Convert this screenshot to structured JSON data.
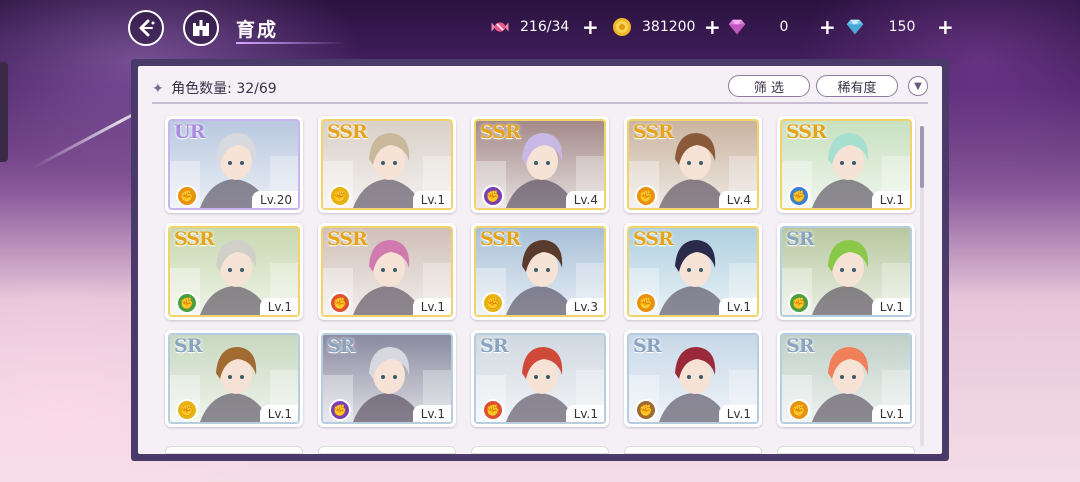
{
  "header": {
    "title": "育成",
    "back_icon": "back-arrow-icon",
    "home_icon": "castle-icon"
  },
  "resources": [
    {
      "name": "candy",
      "icon": "candy-icon",
      "value": "216/34",
      "color": "#e85a8f"
    },
    {
      "name": "gold",
      "icon": "gold-coin-icon",
      "value": "381200",
      "color": "#f2b824"
    },
    {
      "name": "pink-gem",
      "icon": "pink-gem-icon",
      "value": "0",
      "color": "#e07ad8"
    },
    {
      "name": "blue-gem",
      "icon": "blue-gem-icon",
      "value": "150",
      "color": "#6fc7f0"
    }
  ],
  "panel": {
    "count_label": "角色数量:",
    "count_value": "32/69",
    "filter_label": "筛 选",
    "rarity_label": "稀有度"
  },
  "cards": [
    {
      "rarity": "UR",
      "level": "Lv.20",
      "role_color": "#e8920f",
      "hair": "#d9d9e0",
      "bg": "#b9c8e0"
    },
    {
      "rarity": "SSR",
      "level": "Lv.1",
      "role_color": "#e8b20f",
      "hair": "#c9b89a",
      "bg": "#d9d0c8"
    },
    {
      "rarity": "SSR",
      "level": "Lv.4",
      "role_color": "#7a3fb0",
      "hair": "#c8b8e6",
      "bg": "#a48a8a"
    },
    {
      "rarity": "SSR",
      "level": "Lv.4",
      "role_color": "#e8920f",
      "hair": "#8a5a3a",
      "bg": "#c9b3a0"
    },
    {
      "rarity": "SSR",
      "level": "Lv.1",
      "role_color": "#3a7fd0",
      "hair": "#a8e0d0",
      "bg": "#c8e0c0"
    },
    {
      "rarity": "SSR",
      "level": "Lv.1",
      "role_color": "#4aa040",
      "hair": "#d0d0c8",
      "bg": "#c8d8b0"
    },
    {
      "rarity": "SSR",
      "level": "Lv.1",
      "role_color": "#e0502f",
      "hair": "#d07ab0",
      "bg": "#d0c0b8"
    },
    {
      "rarity": "SSR",
      "level": "Lv.3",
      "role_color": "#e8b20f",
      "hair": "#5a3a2a",
      "bg": "#a8c0d8"
    },
    {
      "rarity": "SSR",
      "level": "Lv.1",
      "role_color": "#e8920f",
      "hair": "#2a2a4a",
      "bg": "#b0d0e0"
    },
    {
      "rarity": "SR",
      "level": "Lv.1",
      "role_color": "#4aa040",
      "hair": "#8ac84a",
      "bg": "#b8c8a0"
    },
    {
      "rarity": "SR",
      "level": "Lv.1",
      "role_color": "#e8b20f",
      "hair": "#a06a30",
      "bg": "#c8d8c0"
    },
    {
      "rarity": "SR",
      "level": "Lv.1",
      "role_color": "#7a3fb0",
      "hair": "#d8d8e0",
      "bg": "#8a8aa0"
    },
    {
      "rarity": "SR",
      "level": "Lv.1",
      "role_color": "#e0502f",
      "hair": "#d04a3a",
      "bg": "#d0d8e0"
    },
    {
      "rarity": "SR",
      "level": "Lv.1",
      "role_color": "#a06a30",
      "hair": "#9a2a3a",
      "bg": "#c8d8e8"
    },
    {
      "rarity": "SR",
      "level": "Lv.1",
      "role_color": "#e8920f",
      "hair": "#f0805a",
      "bg": "#c0d0c8"
    }
  ]
}
